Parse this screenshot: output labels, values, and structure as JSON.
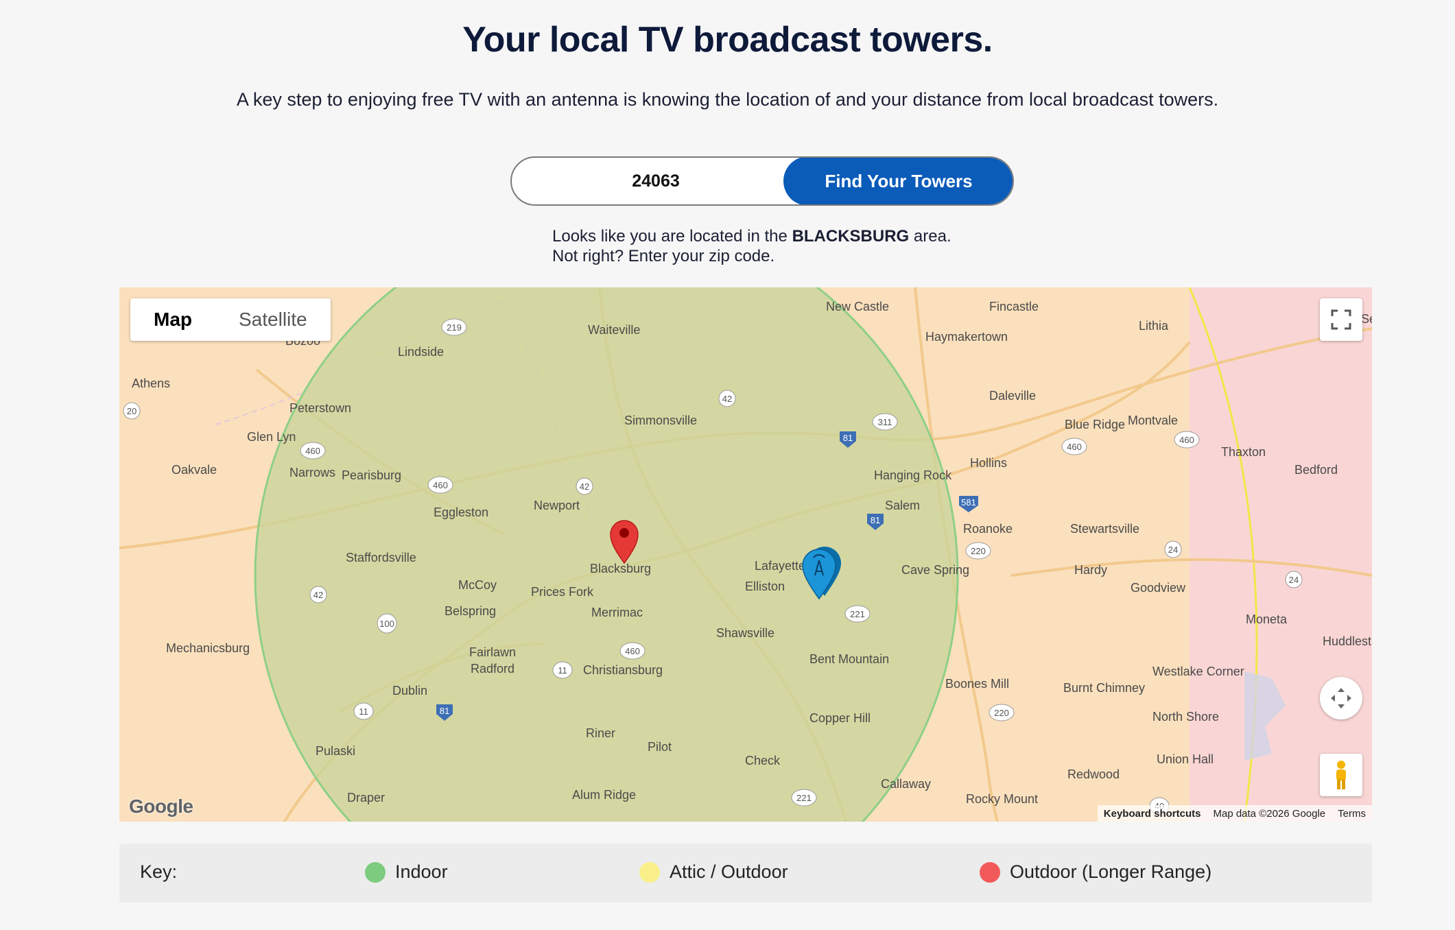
{
  "header": {
    "title": "Your local TV broadcast towers.",
    "subtitle": "A key step to enjoying free TV with an antenna is knowing the location of and your distance from local broadcast towers."
  },
  "search": {
    "zip_value": "24063",
    "button_label": "Find Your Towers"
  },
  "location": {
    "prefix": "Looks like you are located in the",
    "area": "BLACKSBURG",
    "suffix": "area.",
    "line2": "Not right? Enter your zip code."
  },
  "map": {
    "type_options": [
      "Map",
      "Satellite"
    ],
    "selected_type": "Map",
    "logo": "Google",
    "attribution": {
      "shortcuts": "Keyboard shortcuts",
      "data": "Map data ©2026 Google",
      "terms": "Terms"
    },
    "places": [
      "New Castle",
      "Fincastle",
      "Lithia",
      "Waiteville",
      "Bozoo",
      "Lindside",
      "Haymakertown",
      "Athens",
      "Peterstown",
      "Daleville",
      "Simmonsville",
      "Blue Ridge",
      "Montvale",
      "Glen Lyn",
      "Hollins",
      "Thaxton",
      "Oakvale",
      "Narrows",
      "Pearisburg",
      "Hanging Rock",
      "Bedford",
      "Eggleston",
      "Newport",
      "Salem",
      "Roanoke",
      "Stewartsville",
      "Staffordsville",
      "Blacksburg",
      "Lafayette",
      "Cave Spring",
      "McCoy",
      "Prices Fork",
      "Elliston",
      "Hardy",
      "Goodview",
      "Belspring",
      "Merrimac",
      "Moneta",
      "Huddlest",
      "Mechanicsburg",
      "Shawsville",
      "Fairlawn",
      "Radford",
      "Christiansburg",
      "Bent Mountain",
      "Westlake Corner",
      "Boones Mill",
      "Burnt Chimney",
      "Dublin",
      "Copper Hill",
      "North Shore",
      "Riner",
      "Pilot",
      "Pulaski",
      "Check",
      "Union Hall",
      "Redwood",
      "Callaway",
      "Draper",
      "Alum Ridge",
      "Rocky Mount",
      "Se"
    ],
    "route_shields": [
      "219",
      "42",
      "311",
      "460",
      "42",
      "81",
      "581",
      "220",
      "24",
      "460",
      "81",
      "220",
      "221",
      "460",
      "11",
      "100",
      "42",
      "460",
      "81",
      "11",
      "221",
      "220",
      "40",
      "20",
      "460",
      "24"
    ],
    "markers": [
      {
        "name": "user-location",
        "color": "#e53935"
      },
      {
        "name": "broadcast-tower",
        "color": "#0a84c8"
      }
    ],
    "zones": [
      {
        "name": "Indoor",
        "color": "#8fcf88"
      },
      {
        "name": "Attic / Outdoor",
        "color": "#f7ef6e"
      },
      {
        "name": "Outdoor (Longer Range)",
        "color": "#f7a1a6"
      }
    ]
  },
  "key": {
    "label": "Key:",
    "items": [
      {
        "label": "Indoor",
        "color": "#7dcb7e"
      },
      {
        "label": "Attic / Outdoor",
        "color": "#f9f08a"
      },
      {
        "label": "Outdoor (Longer Range)",
        "color": "#f25a5a"
      }
    ]
  }
}
